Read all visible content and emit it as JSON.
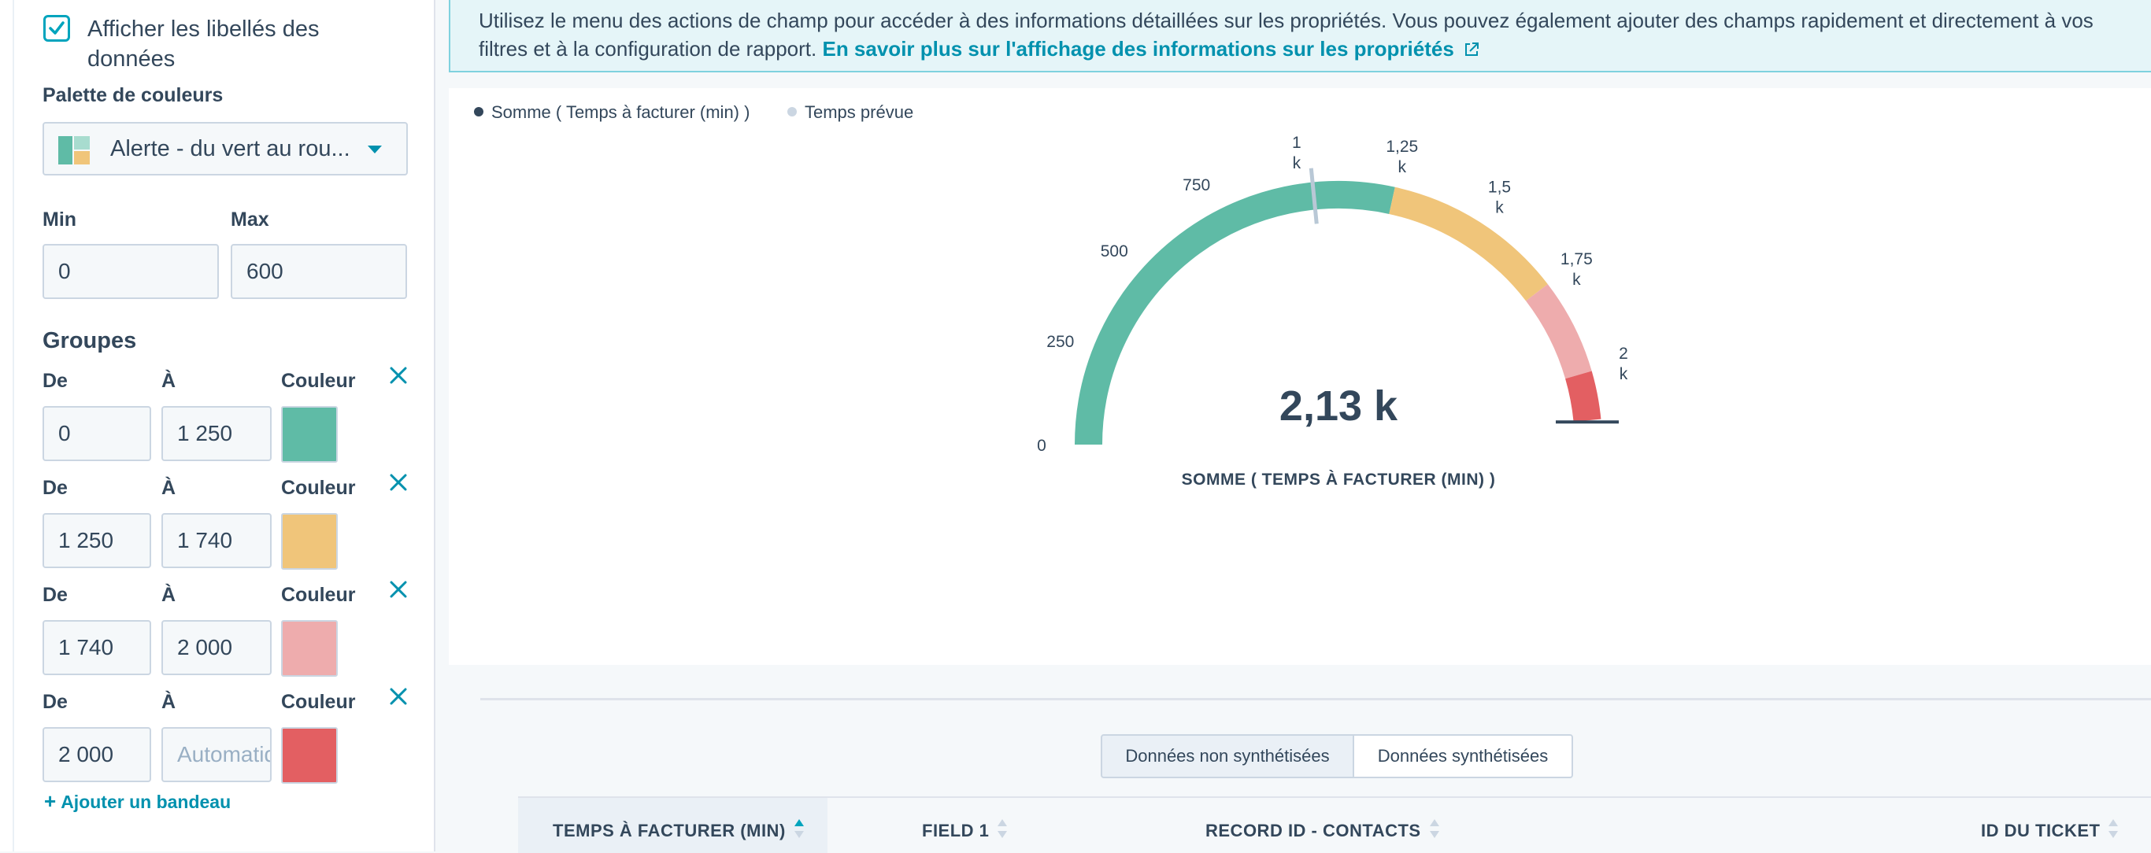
{
  "sidebar": {
    "show_labels": {
      "label": "Afficher les libellés des données",
      "checked": true
    },
    "palette": {
      "section_label": "Palette de couleurs",
      "selected": "Alerte - du vert au rou..."
    },
    "range": {
      "min_label": "Min",
      "max_label": "Max",
      "min_value": "0",
      "max_value": "600"
    },
    "groups": {
      "title": "Groupes",
      "from_label": "De",
      "to_label": "À",
      "color_label": "Couleur",
      "items": [
        {
          "from": "0",
          "to": "1 250",
          "color": "#5fbba6"
        },
        {
          "from": "1 250",
          "to": "1 740",
          "color": "#f0c57a"
        },
        {
          "from": "1 740",
          "to": "2 000",
          "color": "#eeacad"
        },
        {
          "from": "2 000",
          "to": "",
          "to_placeholder": "Automatique",
          "color": "#e35f62"
        }
      ],
      "add_label": "Ajouter un bandeau"
    }
  },
  "banner": {
    "text": "Utilisez le menu des actions de champ pour accéder à des informations détaillées sur les propriétés. Vous pouvez également ajouter des champs rapidement et directement à vos filtres et à la configuration de rapport.",
    "link": "En savoir plus sur l'affichage des informations sur les propriétés"
  },
  "chart_data": {
    "type": "gauge",
    "legend": [
      {
        "name": "Somme ( Temps à facturer (min) )",
        "color": "#33475b"
      },
      {
        "name": "Temps prévue",
        "color": "#cbd6e2"
      }
    ],
    "min": 0,
    "max": 2000,
    "value": 2130,
    "value_label": "2,13 k",
    "target": 1030,
    "title": "SOMME ( TEMPS À FACTURER (MIN) )",
    "ticks": [
      {
        "value": 0,
        "label": [
          "0"
        ]
      },
      {
        "value": 250,
        "label": [
          "250"
        ]
      },
      {
        "value": 500,
        "label": [
          "500"
        ]
      },
      {
        "value": 750,
        "label": [
          "750"
        ]
      },
      {
        "value": 1000,
        "label": [
          "1",
          "k"
        ]
      },
      {
        "value": 1250,
        "label": [
          "1,25",
          "k"
        ]
      },
      {
        "value": 1500,
        "label": [
          "1,5",
          "k"
        ]
      },
      {
        "value": 1750,
        "label": [
          "1,75",
          "k"
        ]
      },
      {
        "value": 2000,
        "label": [
          "2",
          "k"
        ]
      }
    ],
    "bands": [
      {
        "from": 0,
        "to": 1250,
        "color": "#5fbba6"
      },
      {
        "from": 1250,
        "to": 1740,
        "color": "#f0c57a"
      },
      {
        "from": 1740,
        "to": 2000,
        "color": "#eeacad"
      },
      {
        "from": 2000,
        "to": 2130,
        "color": "#e35f62"
      }
    ]
  },
  "table": {
    "toggle": {
      "unsummarized": "Données non synthétisées",
      "summarized": "Données synthétisées",
      "active": "unsummarized"
    },
    "columns": [
      "TEMPS À FACTURER (MIN)",
      "FIELD 1",
      "RECORD ID - CONTACTS",
      "ID DU TICKET"
    ]
  },
  "colors": {
    "accent": "#00a4bd",
    "link": "#0091ae",
    "text": "#33475b",
    "border": "#cbd6e2"
  }
}
